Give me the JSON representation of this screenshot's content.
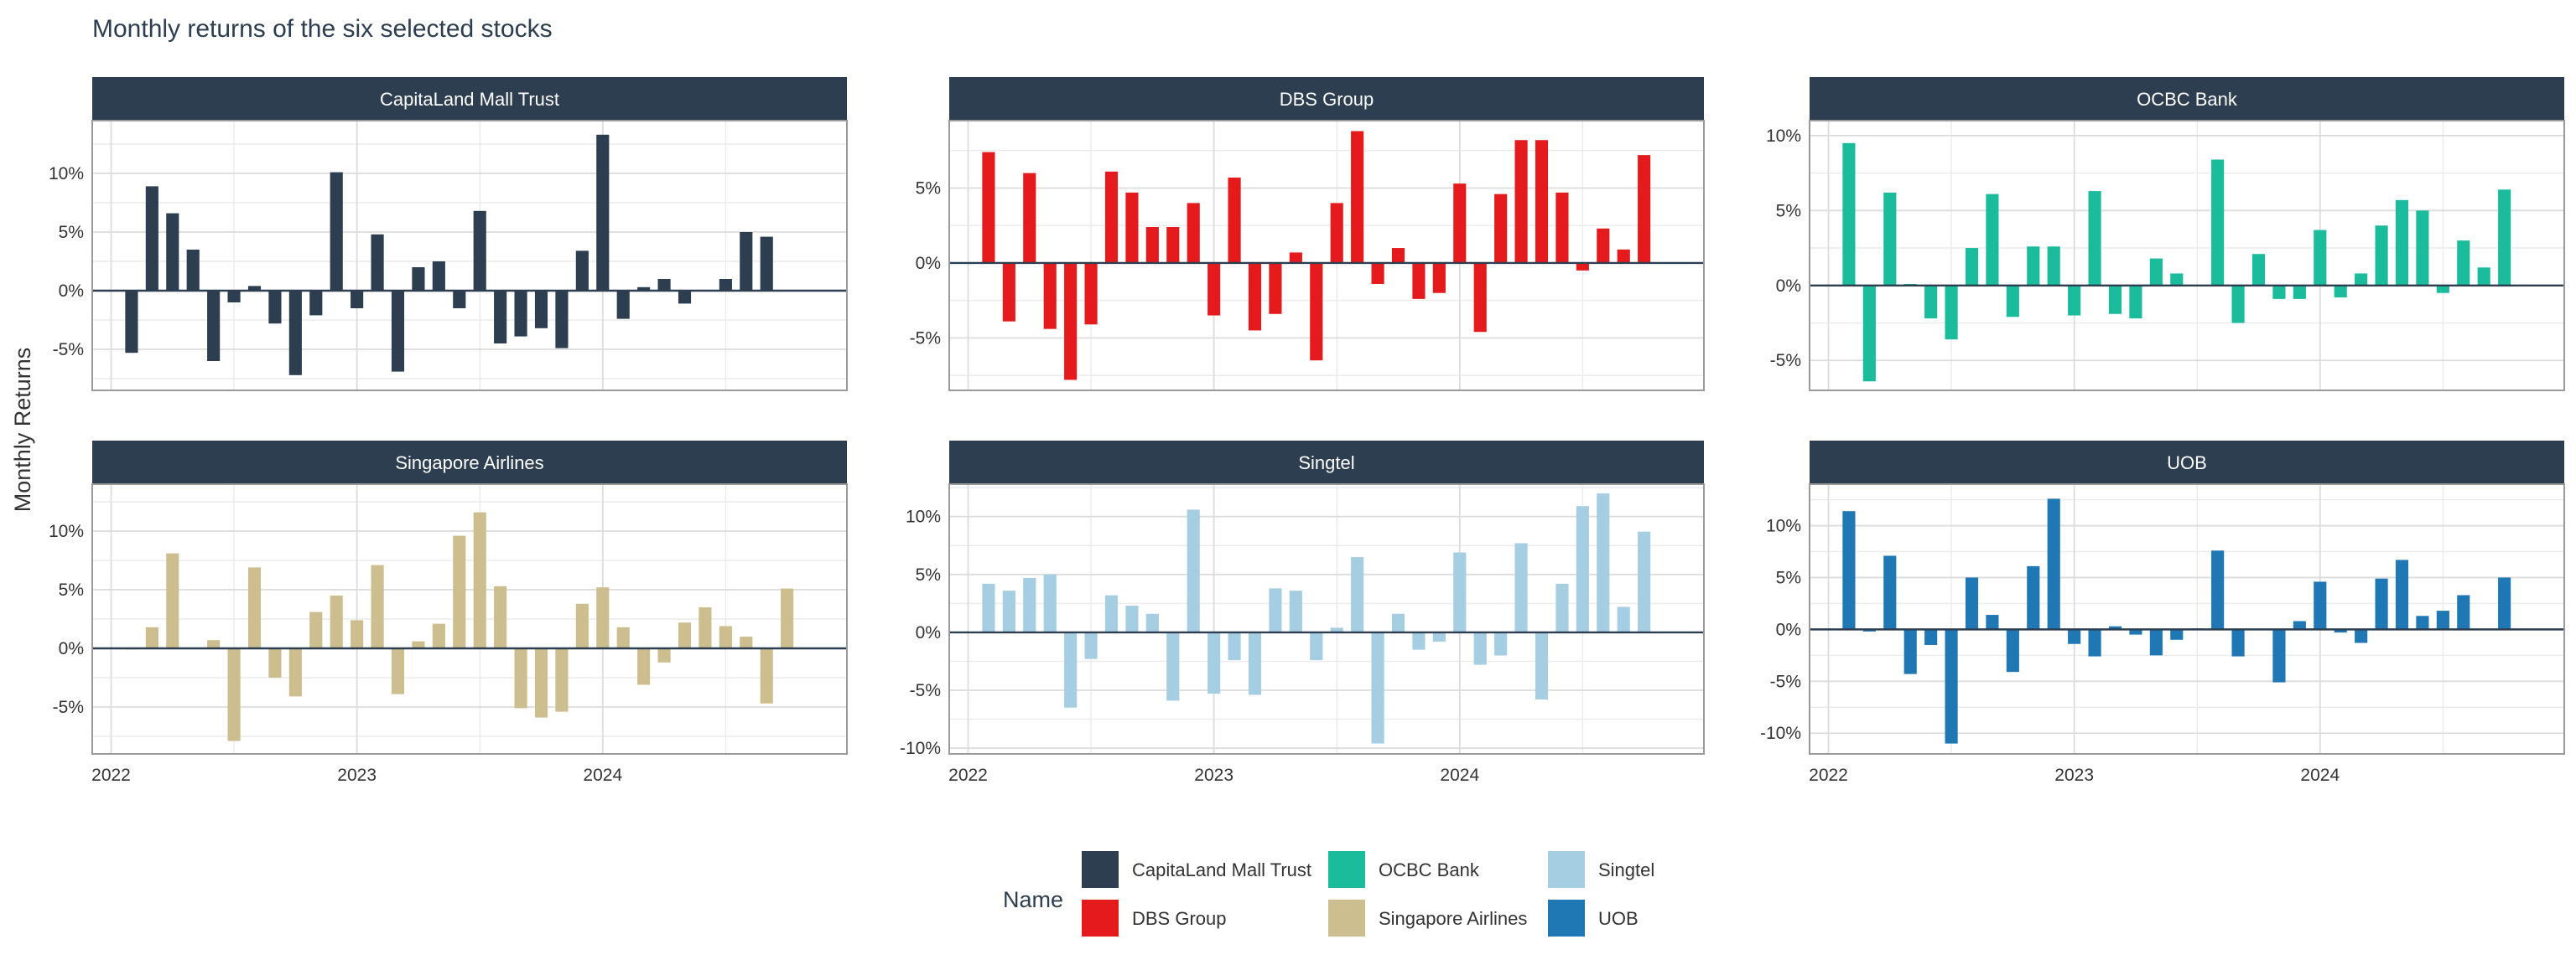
{
  "chart_data": {
    "type": "bar",
    "title": "Monthly returns of the six selected stocks",
    "ylabel": "Monthly Returns",
    "xlabel": "",
    "x_ticks": [
      "2022",
      "2023",
      "2024"
    ],
    "dates": [
      "2022-01",
      "2022-02",
      "2022-03",
      "2022-04",
      "2022-05",
      "2022-06",
      "2022-07",
      "2022-08",
      "2022-09",
      "2022-10",
      "2022-11",
      "2022-12",
      "2023-01",
      "2023-02",
      "2023-03",
      "2023-04",
      "2023-05",
      "2023-06",
      "2023-07",
      "2023-08",
      "2023-09",
      "2023-10",
      "2023-11",
      "2023-12",
      "2024-01",
      "2024-02",
      "2024-03",
      "2024-04",
      "2024-05",
      "2024-06",
      "2024-07",
      "2024-08",
      "2024-09",
      "2024-10"
    ],
    "legend": {
      "title": "Name",
      "position": "bottom"
    },
    "grid": true,
    "facets": [
      {
        "name": "CapitaLand Mall Trust",
        "color": "#2c3e50",
        "ylim": [
          -8.5,
          14.5
        ],
        "yticks": [
          -5,
          0,
          5,
          10
        ],
        "ytick_labels": [
          "-5%",
          "0%",
          "5%",
          "10%"
        ],
        "values": [
          -5.3,
          8.9,
          6.6,
          3.5,
          -6.0,
          -1.0,
          0.4,
          -2.8,
          -7.2,
          -2.1,
          10.1,
          -1.5,
          4.8,
          -6.9,
          2.0,
          2.5,
          -1.5,
          6.8,
          -4.5,
          -3.9,
          -3.2,
          -4.9,
          3.4,
          13.3,
          -2.4,
          0.3,
          1.0,
          -1.1,
          0,
          1.0,
          5.0,
          4.6
        ]
      },
      {
        "name": "DBS Group",
        "color": "#e41a1c",
        "ylim": [
          -8.5,
          9.5
        ],
        "yticks": [
          -5,
          0,
          5
        ],
        "ytick_labels": [
          "-5%",
          "0%",
          "5%"
        ],
        "values": [
          7.4,
          -3.9,
          6.0,
          -4.4,
          -7.8,
          -4.1,
          6.1,
          4.7,
          2.4,
          2.4,
          4.0,
          -3.5,
          5.7,
          -4.5,
          -3.4,
          0.7,
          -6.5,
          4.0,
          8.8,
          -1.4,
          1.0,
          -2.4,
          -2.0,
          5.3,
          -4.6,
          4.6,
          8.2,
          8.2,
          4.7,
          -0.5,
          2.3,
          0.9,
          7.2
        ]
      },
      {
        "name": "OCBC Bank",
        "color": "#1abc9c",
        "ylim": [
          -7,
          11
        ],
        "yticks": [
          -5,
          0,
          5,
          10
        ],
        "ytick_labels": [
          "-5%",
          "0%",
          "5%",
          "10%"
        ],
        "values": [
          9.5,
          -6.4,
          6.2,
          0.1,
          -2.2,
          -3.6,
          2.5,
          6.1,
          -2.1,
          2.6,
          2.6,
          -2.0,
          6.3,
          -1.9,
          -2.2,
          1.8,
          0.8,
          0,
          8.4,
          -2.5,
          2.1,
          -0.9,
          -0.9,
          3.7,
          -0.8,
          0.8,
          4.0,
          5.7,
          5.0,
          -0.5,
          3.0,
          1.2,
          6.4
        ]
      },
      {
        "name": "Singapore Airlines",
        "color": "#cdbe8f",
        "ylim": [
          -9,
          14
        ],
        "yticks": [
          -5,
          0,
          5,
          10
        ],
        "ytick_labels": [
          "-5%",
          "0%",
          "5%",
          "10%"
        ],
        "values": [
          -0.1,
          1.8,
          8.1,
          0,
          0.7,
          -7.9,
          6.9,
          -2.5,
          -4.1,
          3.1,
          4.5,
          2.4,
          7.1,
          -3.9,
          0.6,
          2.1,
          9.6,
          11.6,
          5.3,
          -5.1,
          -5.9,
          -5.4,
          3.8,
          5.2,
          1.8,
          -3.1,
          -1.2,
          2.2,
          3.5,
          1.9,
          1.0,
          -4.7,
          5.1
        ]
      },
      {
        "name": "Singtel",
        "color": "#a6cee3",
        "ylim": [
          -10.5,
          12.8
        ],
        "yticks": [
          -10,
          -5,
          0,
          5,
          10
        ],
        "ytick_labels": [
          "-10%",
          "-5%",
          "0%",
          "5%",
          "10%"
        ],
        "values": [
          4.2,
          3.6,
          4.7,
          5.0,
          -6.5,
          -2.3,
          3.2,
          2.3,
          1.6,
          -5.9,
          10.6,
          -5.3,
          -2.4,
          -5.4,
          3.8,
          3.6,
          -2.4,
          0.4,
          6.5,
          -9.6,
          1.6,
          -1.5,
          -0.8,
          6.9,
          -2.8,
          -2.0,
          7.7,
          -5.8,
          4.2,
          10.9,
          12.0,
          2.2,
          8.7
        ]
      },
      {
        "name": "UOB",
        "color": "#1f78b4",
        "ylim": [
          -12,
          14
        ],
        "yticks": [
          -10,
          -5,
          0,
          5,
          10
        ],
        "ytick_labels": [
          "-10%",
          "-5%",
          "0%",
          "5%",
          "10%"
        ],
        "values": [
          11.4,
          -0.2,
          7.1,
          -4.3,
          -1.5,
          -11.0,
          5.0,
          1.4,
          -4.1,
          6.1,
          12.6,
          -1.4,
          -2.6,
          0.3,
          -0.5,
          -2.5,
          -1.0,
          0.1,
          7.6,
          -2.6,
          0,
          -5.1,
          0.8,
          4.6,
          -0.3,
          -1.3,
          4.9,
          6.7,
          1.3,
          1.8,
          3.3,
          0,
          5.0
        ]
      }
    ]
  }
}
